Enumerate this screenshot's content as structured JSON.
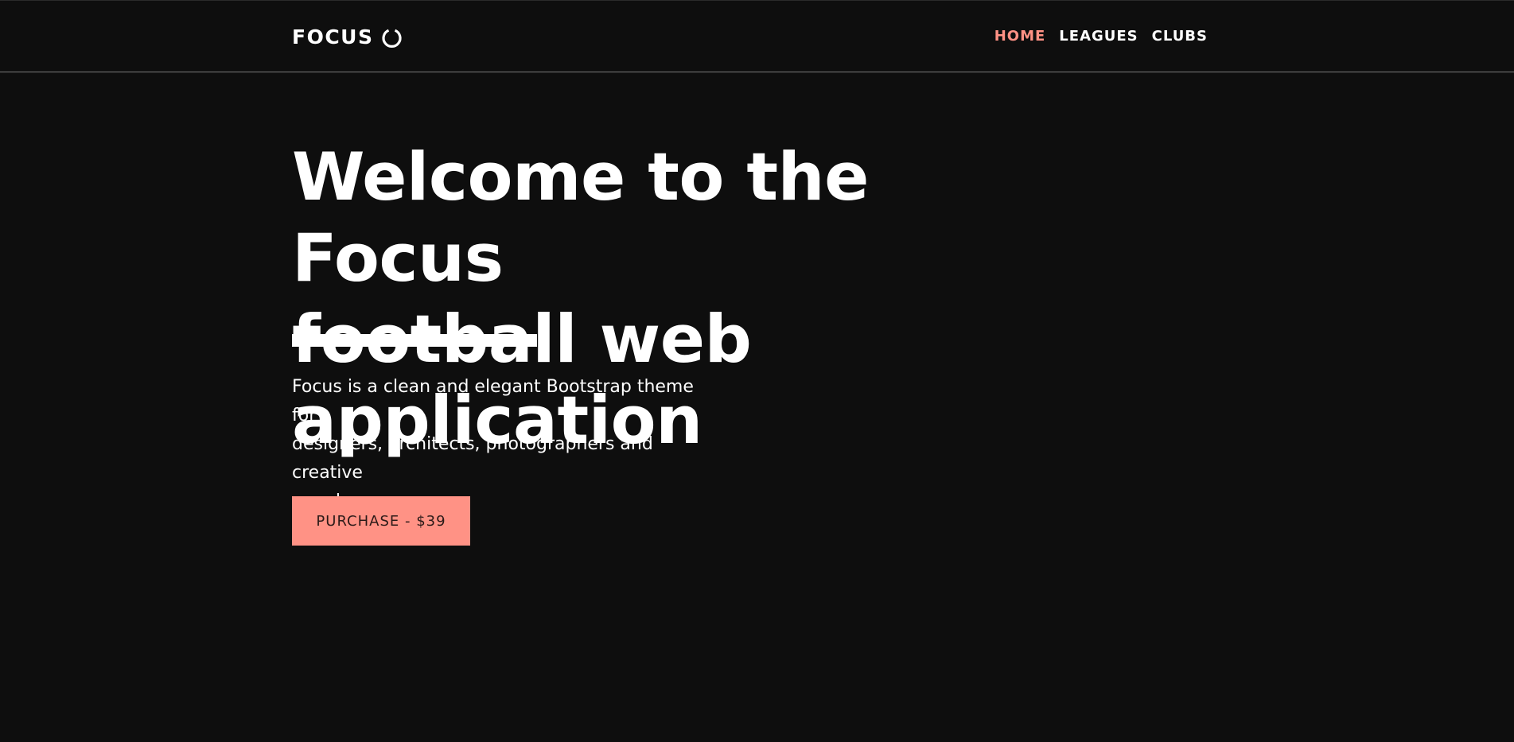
{
  "theme": {
    "accent": "#ff9285",
    "background": "#0e0e0e",
    "text": "#ffffff"
  },
  "navbar": {
    "brand": "FOCUS",
    "brand_icon": "circle-notch-icon",
    "links": [
      {
        "label": "HOME",
        "active": true
      },
      {
        "label": "LEAGUES",
        "active": false
      },
      {
        "label": "CLUBS",
        "active": false
      }
    ]
  },
  "hero": {
    "title_line1": "Welcome to the Focus",
    "title_line2": "football web application",
    "lead_line1": "Focus is a clean and elegant Bootstrap theme for",
    "lead_line2": "designers, architects, photographers and creative",
    "lead_line3": "people.",
    "button_label": "PURCHASE - $39"
  }
}
